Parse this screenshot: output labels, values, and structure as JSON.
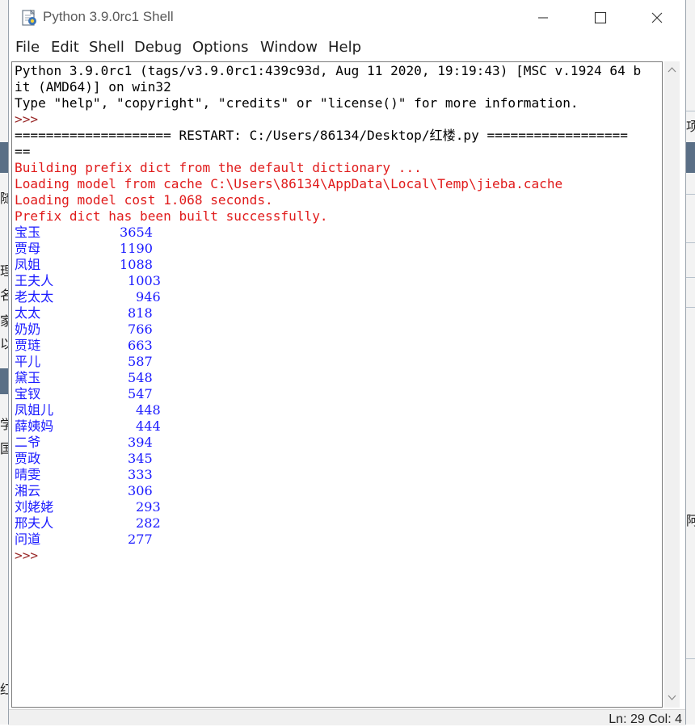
{
  "window": {
    "title": "Python 3.9.0rc1 Shell"
  },
  "menu": [
    "File",
    "Edit",
    "Shell",
    "Debug",
    "Options",
    "Window",
    "Help"
  ],
  "console": {
    "header": [
      "Python 3.9.0rc1 (tags/v3.9.0rc1:439c93d, Aug 11 2020, 19:19:43) [MSC v.1924 64 b",
      "it (AMD64)] on win32",
      "Type \"help\", \"copyright\", \"credits\" or \"license()\" for more information."
    ],
    "prompt": ">>> ",
    "restart_line_1": "==================== RESTART: C:/Users/86134/Desktop/红楼.py ==================",
    "restart_line_2": "==",
    "stderr": [
      "Building prefix dict from the default dictionary ...",
      "Loading model from cache C:\\Users\\86134\\AppData\\Local\\Temp\\jieba.cache",
      "Loading model cost 1.068 seconds.",
      "Prefix dict has been built successfully."
    ],
    "results": [
      {
        "name": "宝玉",
        "count": "3654"
      },
      {
        "name": "贾母",
        "count": "1190"
      },
      {
        "name": "凤姐",
        "count": "1088"
      },
      {
        "name": "王夫人",
        "count": "1003"
      },
      {
        "name": "老太太",
        "count": "946"
      },
      {
        "name": "太太",
        "count": "818"
      },
      {
        "name": "奶奶",
        "count": "766"
      },
      {
        "name": "贾琏",
        "count": "663"
      },
      {
        "name": "平儿",
        "count": "587"
      },
      {
        "name": "黛玉",
        "count": "548"
      },
      {
        "name": "宝钗",
        "count": "547"
      },
      {
        "name": "凤姐儿",
        "count": "448"
      },
      {
        "name": "薛姨妈",
        "count": "444"
      },
      {
        "name": "二爷",
        "count": "394"
      },
      {
        "name": "贾政",
        "count": "345"
      },
      {
        "name": "晴雯",
        "count": "333"
      },
      {
        "name": "湘云",
        "count": "306"
      },
      {
        "name": "刘姥姥",
        "count": "293"
      },
      {
        "name": "邢夫人",
        "count": "282"
      },
      {
        "name": "问道",
        "count": "277"
      }
    ],
    "final_prompt": ">>> "
  },
  "status": {
    "text": "Ln: 29  Col: 4"
  },
  "background": {
    "left_glyphs": [
      "随",
      "理",
      "名",
      "家",
      "以",
      "学",
      "国",
      "红"
    ],
    "right_glyphs": [
      "项",
      "阿"
    ]
  },
  "colors": {
    "stderr": "#e01b1b",
    "stdout": "#1a1aff",
    "prompt": "#9a2a2a"
  }
}
